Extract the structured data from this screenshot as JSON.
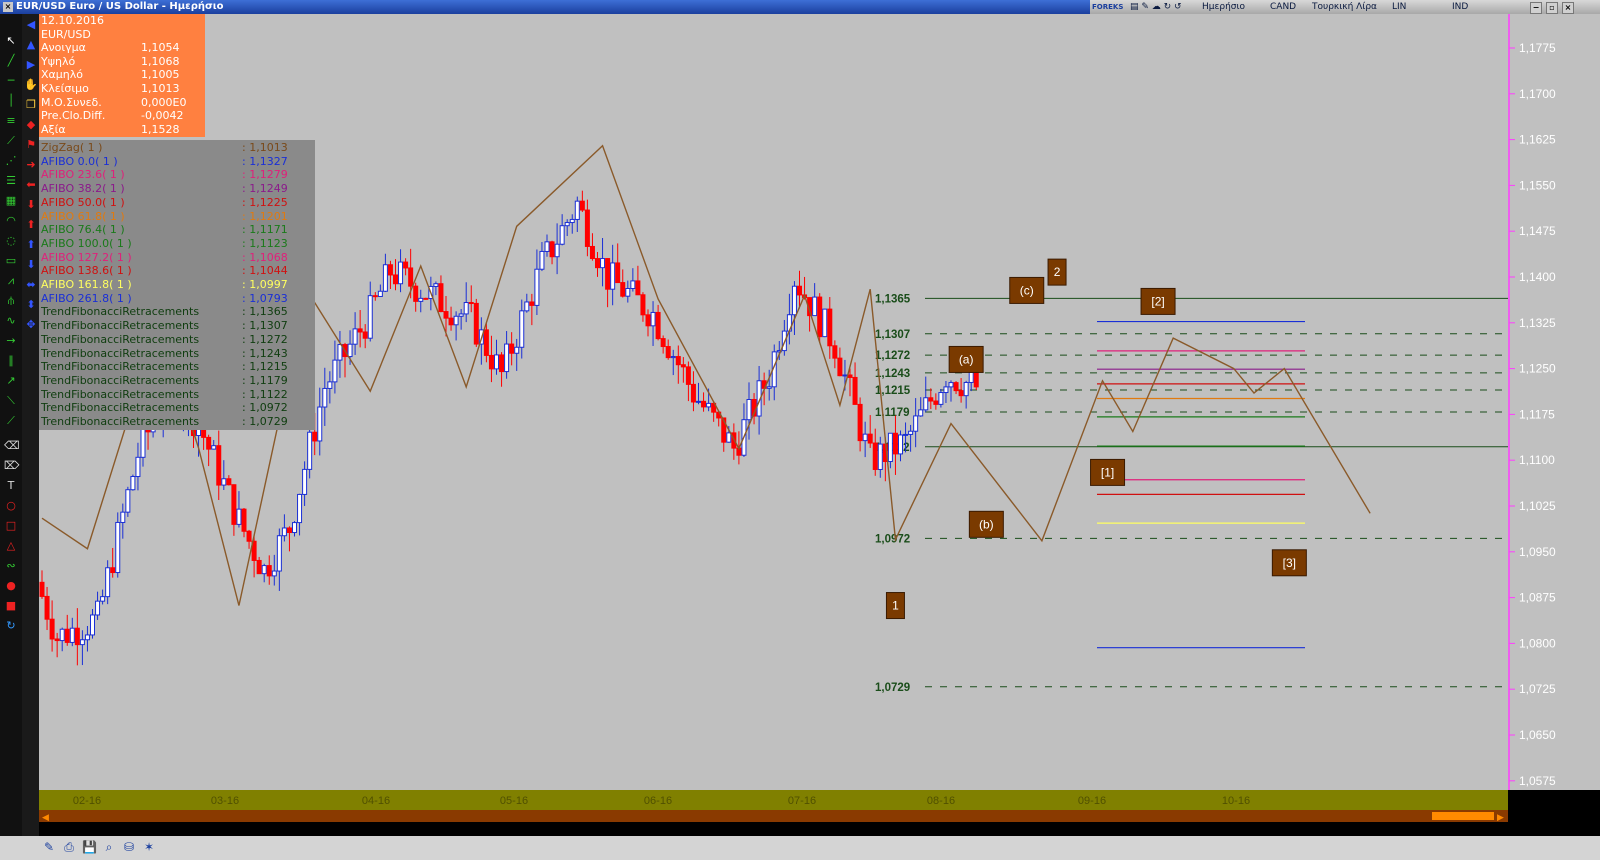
{
  "window": {
    "title": "EUR/USD Euro / US Dollar - Ημερήσιο",
    "close_glyph": "×",
    "menu": [
      "Ημερήσιο",
      "CAND",
      "Τουρκική Λίρα",
      "LIN",
      "IND"
    ],
    "brand": "FOREKS"
  },
  "info": {
    "date": "12.10.2016",
    "symbol": "EUR/USD",
    "rows": [
      {
        "label": "Ανοιγμα",
        "value": "1,1054"
      },
      {
        "label": "Υψηλό",
        "value": "1,1068"
      },
      {
        "label": "Χαμηλό",
        "value": "1,1005"
      },
      {
        "label": "Κλείσιμο",
        "value": "1,1013"
      },
      {
        "label": "Μ.Ο.Συνεδ.",
        "value": "0,000E0"
      },
      {
        "label": "Pre.Clo.Diff.",
        "value": "-0,0042"
      },
      {
        "label": "Αξία",
        "value": "1,1528"
      }
    ]
  },
  "legend": [
    {
      "label": "ZigZag( 1 )",
      "value": ": 1,1013",
      "color": "#7a4a1a"
    },
    {
      "label": "AFIBO 0.0( 1 )",
      "value": ": 1,1327",
      "color": "#1a2fd6"
    },
    {
      "label": "AFIBO 23.6( 1 )",
      "value": ": 1,1279",
      "color": "#e0207a"
    },
    {
      "label": "AFIBO 38.2( 1 )",
      "value": ": 1,1249",
      "color": "#8b1a8b"
    },
    {
      "label": "AFIBO 50.0( 1 )",
      "value": ": 1,1225",
      "color": "#d01010"
    },
    {
      "label": "AFIBO 61.8( 1 )",
      "value": ": 1,1201",
      "color": "#e07a10"
    },
    {
      "label": "AFIBO 76.4( 1 )",
      "value": ": 1,1171",
      "color": "#1a7a1a"
    },
    {
      "label": "AFIBO 100.0( 1 )",
      "value": ": 1,1123",
      "color": "#1a7a1a"
    },
    {
      "label": "AFIBO 127.2( 1 )",
      "value": ": 1,1068",
      "color": "#e0207a"
    },
    {
      "label": "AFIBO 138.6( 1 )",
      "value": ": 1,1044",
      "color": "#d01010"
    },
    {
      "label": "AFIBO 161.8( 1 )",
      "value": ": 1,0997",
      "color": "#ffff60"
    },
    {
      "label": "AFIBO 261.8( 1 )",
      "value": ": 1,0793",
      "color": "#1a2fd6"
    },
    {
      "label": "TrendFibonacciRetracements",
      "value": ": 1,1365",
      "color": "#0f3d0f"
    },
    {
      "label": "TrendFibonacciRetracements",
      "value": ": 1,1307",
      "color": "#0f3d0f"
    },
    {
      "label": "TrendFibonacciRetracements",
      "value": ": 1,1272",
      "color": "#0f3d0f"
    },
    {
      "label": "TrendFibonacciRetracements",
      "value": ": 1,1243",
      "color": "#0f3d0f"
    },
    {
      "label": "TrendFibonacciRetracements",
      "value": ": 1,1215",
      "color": "#0f3d0f"
    },
    {
      "label": "TrendFibonacciRetracements",
      "value": ": 1,1179",
      "color": "#0f3d0f"
    },
    {
      "label": "TrendFibonacciRetracements",
      "value": ": 1,1122",
      "color": "#0f3d0f"
    },
    {
      "label": "TrendFibonacciRetracements",
      "value": ": 1,0972",
      "color": "#0f3d0f"
    },
    {
      "label": "TrendFibonacciRetracements",
      "value": ": 1,0729",
      "color": "#0f3d0f"
    }
  ],
  "colors": {
    "background": "#c0c0c0",
    "up_candle": "#1a2fd6",
    "down_candle": "#ff0000",
    "zigzag": "#8a5a2a",
    "fib_line": "#1a4d1a",
    "fib_label": "#1a4d1a",
    "label_box": "#7a3a00",
    "label_text": "#ffffff",
    "axis_text": "#ffffff",
    "magenta_line": "#ff3cff",
    "date_axis_bg": "#808000",
    "date_text": "#505000",
    "scrollbar": "#8a3a00",
    "scroll_thumb": "#ff8a00"
  },
  "chart_data": {
    "type": "candlestick",
    "title": "",
    "ylim": [
      1.0575,
      1.1825
    ],
    "yticks": [
      "1,1775",
      "1,1700",
      "1,1625",
      "1,1550",
      "1,1475",
      "1,1400",
      "1,1325",
      "1,1250",
      "1,1175",
      "1,1100",
      "1,1025",
      "1,0950",
      "1,0875",
      "1,0800",
      "1,0725",
      "1,0650",
      "1,0575"
    ],
    "xticks": [
      "02-16",
      "03-16",
      "04-16",
      "05-16",
      "06-16",
      "07-16",
      "08-16",
      "09-16",
      "10-16"
    ],
    "candle_count": 186,
    "first_index": 0,
    "candle_anchors": [
      [
        0,
        1.09
      ],
      [
        4,
        1.081
      ],
      [
        12,
        1.084
      ],
      [
        20,
        1.111
      ],
      [
        26,
        1.122
      ],
      [
        32,
        1.116
      ],
      [
        40,
        1.1
      ],
      [
        45,
        1.092
      ],
      [
        50,
        1.099
      ],
      [
        57,
        1.122
      ],
      [
        66,
        1.134
      ],
      [
        70,
        1.141
      ],
      [
        78,
        1.137
      ],
      [
        86,
        1.133
      ],
      [
        92,
        1.124
      ],
      [
        100,
        1.142
      ],
      [
        107,
        1.152
      ],
      [
        113,
        1.14
      ],
      [
        122,
        1.134
      ],
      [
        130,
        1.121
      ],
      [
        138,
        1.112
      ],
      [
        145,
        1.124
      ],
      [
        150,
        1.14
      ],
      [
        158,
        1.129
      ],
      [
        165,
        1.11
      ],
      [
        172,
        1.113
      ],
      [
        180,
        1.124
      ],
      [
        186,
        1.122
      ],
      [
        190,
        1.129
      ],
      [
        196,
        1.127
      ],
      [
        202,
        1.117
      ],
      [
        208,
        1.112
      ],
      [
        213,
        1.121
      ],
      [
        218,
        1.122
      ],
      [
        223,
        1.11
      ],
      [
        228,
        1.102
      ]
    ],
    "zigzag": [
      [
        0,
        1.1005
      ],
      [
        9,
        1.0955
      ],
      [
        23,
        1.1325
      ],
      [
        31,
        1.112
      ],
      [
        39,
        1.0862
      ],
      [
        50,
        1.1283
      ],
      [
        54,
        1.1358
      ],
      [
        65,
        1.1213
      ],
      [
        75,
        1.1418
      ],
      [
        84,
        1.122
      ],
      [
        94,
        1.1483
      ],
      [
        111,
        1.1615
      ],
      [
        122,
        1.1364
      ],
      [
        138,
        1.1119
      ],
      [
        151,
        1.137
      ],
      [
        158,
        1.119
      ],
      [
        164,
        1.138
      ],
      [
        169,
        1.097
      ],
      [
        180,
        1.116
      ],
      [
        198,
        1.0968
      ],
      [
        210,
        1.123
      ],
      [
        216,
        1.1147
      ],
      [
        224,
        1.13
      ],
      [
        236,
        1.125
      ],
      [
        240,
        1.121
      ],
      [
        246,
        1.125
      ],
      [
        263,
        1.1013
      ]
    ],
    "fib_levels": [
      {
        "label": "1,1365",
        "value": 1.1365,
        "style": "solid"
      },
      {
        "label": "1,1307",
        "value": 1.1307,
        "style": "dashed"
      },
      {
        "label": "1,1272",
        "value": 1.1272,
        "style": "dashed"
      },
      {
        "label": "1,1243",
        "value": 1.1243,
        "style": "dashed"
      },
      {
        "label": "1,1215",
        "value": 1.1215,
        "style": "dashed"
      },
      {
        "label": "1,1179",
        "value": 1.1179,
        "style": "dashed"
      },
      {
        "label": "1,1122",
        "value": 1.1122,
        "style": "solid"
      },
      {
        "label": "1,0972",
        "value": 1.0972,
        "style": "dashed"
      },
      {
        "label": "1,0729",
        "value": 1.0729,
        "style": "dashed"
      }
    ],
    "afibo_levels": [
      {
        "value": 1.1327,
        "color": "#1a2fd6"
      },
      {
        "value": 1.1279,
        "color": "#e0207a"
      },
      {
        "value": 1.1249,
        "color": "#8b1a8b"
      },
      {
        "value": 1.1225,
        "color": "#d01010"
      },
      {
        "value": 1.1201,
        "color": "#e07a10"
      },
      {
        "value": 1.1171,
        "color": "#1a7a1a"
      },
      {
        "value": 1.1123,
        "color": "#1a7a1a"
      },
      {
        "value": 1.1068,
        "color": "#e0207a"
      },
      {
        "value": 1.1044,
        "color": "#d01010"
      },
      {
        "value": 1.0997,
        "color": "#ffff60"
      },
      {
        "value": 1.0793,
        "color": "#1a2fd6"
      }
    ],
    "wave_labels": [
      {
        "text": "1",
        "x": 169,
        "y": 1.0862
      },
      {
        "text": "2",
        "x": 201,
        "y": 1.1408
      },
      {
        "text": "(a)",
        "x": 183,
        "y": 1.1265
      },
      {
        "text": "(b)",
        "x": 187,
        "y": 1.0995
      },
      {
        "text": "(c)",
        "x": 195,
        "y": 1.1378
      },
      {
        "text": "[1]",
        "x": 211,
        "y": 1.108
      },
      {
        "text": "[2]",
        "x": 221,
        "y": 1.136
      },
      {
        "text": "[3]",
        "x": 247,
        "y": 1.0932
      }
    ],
    "last_close": "1,1013"
  }
}
